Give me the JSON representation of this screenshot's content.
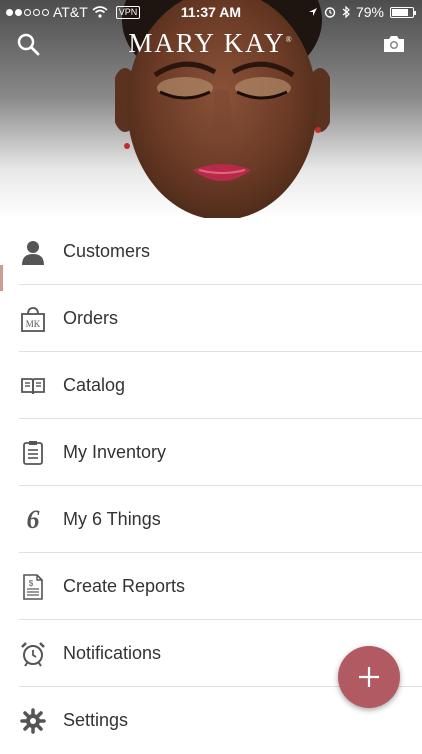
{
  "status_bar": {
    "carrier": "AT&T",
    "vpn": "VPN",
    "time": "11:37 AM",
    "battery": "79%",
    "battery_level": 0.79,
    "signal_bars": 2
  },
  "header": {
    "brand": "MARY KAY",
    "brand_mark": "®",
    "search_icon": "search-icon",
    "camera_icon": "camera-icon"
  },
  "menu": {
    "items": [
      {
        "label": "Customers",
        "icon": "customer-icon"
      },
      {
        "label": "Orders",
        "icon": "shopping-bag-icon",
        "icon_text": "MK"
      },
      {
        "label": "Catalog",
        "icon": "open-book-icon"
      },
      {
        "label": "My Inventory",
        "icon": "clipboard-icon"
      },
      {
        "label": "My 6 Things",
        "icon": "six-icon",
        "icon_text": "6"
      },
      {
        "label": "Create Reports",
        "icon": "report-icon"
      },
      {
        "label": "Notifications",
        "icon": "alarm-clock-icon"
      },
      {
        "label": "Settings",
        "icon": "gear-icon"
      }
    ]
  },
  "fab": {
    "icon": "plus-icon"
  },
  "colors": {
    "accent": "#b25a62",
    "text": "#333333",
    "divider": "#e0e0e0",
    "icon": "#555555"
  }
}
